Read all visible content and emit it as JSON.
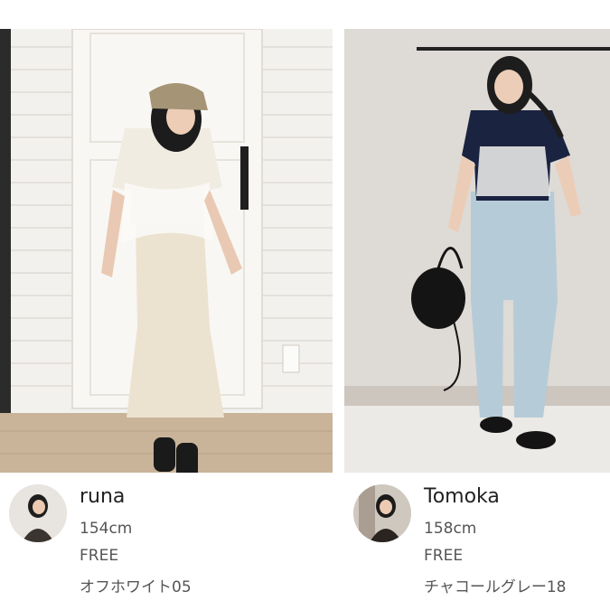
{
  "staff": [
    {
      "name": "runa",
      "height": "154cm",
      "size": "FREE",
      "color": "オフホワイト05"
    },
    {
      "name": "Tomoka",
      "height": "158cm",
      "size": "FREE",
      "color": "チャコールグレー18"
    }
  ]
}
